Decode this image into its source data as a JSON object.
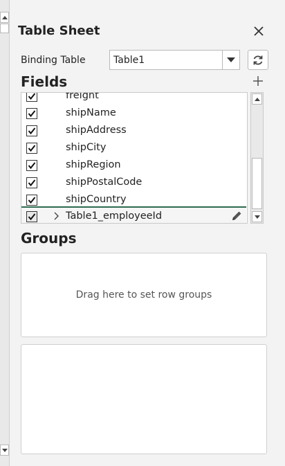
{
  "panel": {
    "title": "Table Sheet",
    "binding_label": "Binding Table",
    "binding_value": "Table1",
    "fields_title": "Fields",
    "groups_title": "Groups",
    "groups_hint": "Drag here to set row groups"
  },
  "fields": [
    {
      "name": "freight",
      "checked": true
    },
    {
      "name": "shipName",
      "checked": true
    },
    {
      "name": "shipAddress",
      "checked": true
    },
    {
      "name": "shipCity",
      "checked": true
    },
    {
      "name": "shipRegion",
      "checked": true
    },
    {
      "name": "shipPostalCode",
      "checked": true
    },
    {
      "name": "shipCountry",
      "checked": true
    }
  ],
  "related_table": {
    "name": "Table1_employeeId",
    "checked": true
  },
  "icons": {
    "close": "close-icon",
    "refresh": "refresh-icon",
    "add": "plus-icon",
    "expand": "chevron-right-icon",
    "edit": "pencil-icon",
    "dropdown": "chevron-down-icon"
  },
  "colors": {
    "accent": "#2d6a4f"
  }
}
